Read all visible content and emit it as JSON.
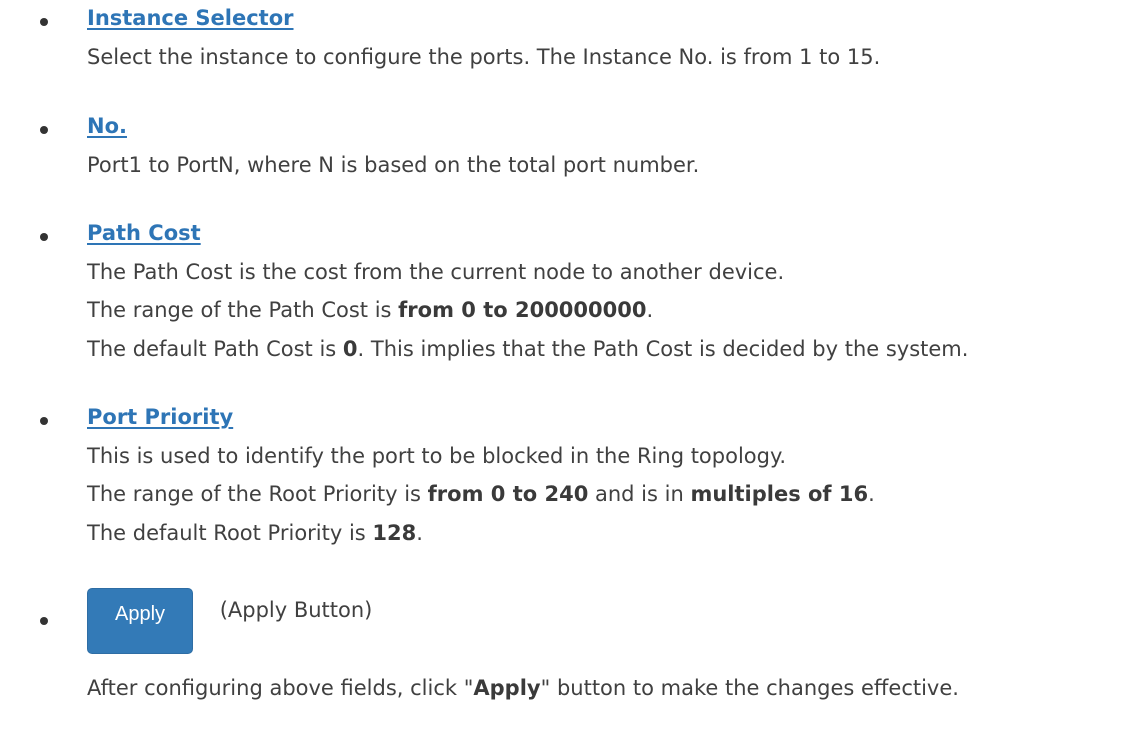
{
  "sections": [
    {
      "heading": "Instance Selector",
      "lines": [
        "Select the instance to configure the ports. The Instance No. is from 1 to 15."
      ]
    },
    {
      "heading": "No.",
      "lines": [
        "Port1 to PortN, where N is based on the total port number."
      ]
    },
    {
      "heading": "Path Cost",
      "line1": "The Path Cost is the cost from the current node to another device.",
      "line2_pre": "The range of the Path Cost is ",
      "line2_bold": "from 0 to 200000000",
      "line2_post": ".",
      "line3_pre": "The default Path Cost is ",
      "line3_bold": "0",
      "line3_post": ". This implies that the Path Cost is decided by the system."
    },
    {
      "heading": "Port Priority",
      "line1": "This is used to identify the port to be blocked in the Ring topology.",
      "line2_pre": "The range of the Root Priority is ",
      "line2_bold1": "from 0 to 240",
      "line2_mid": " and is in ",
      "line2_bold2": "multiples of 16",
      "line2_post": ".",
      "line3_pre": "The default Root Priority is ",
      "line3_bold": "128",
      "line3_post": "."
    }
  ],
  "apply": {
    "button_label": "Apply",
    "button_caption": "(Apply Button)",
    "desc_pre": "After configuring above fields, click \"",
    "desc_bold": "Apply",
    "desc_post": "\" button to make the changes effective."
  }
}
